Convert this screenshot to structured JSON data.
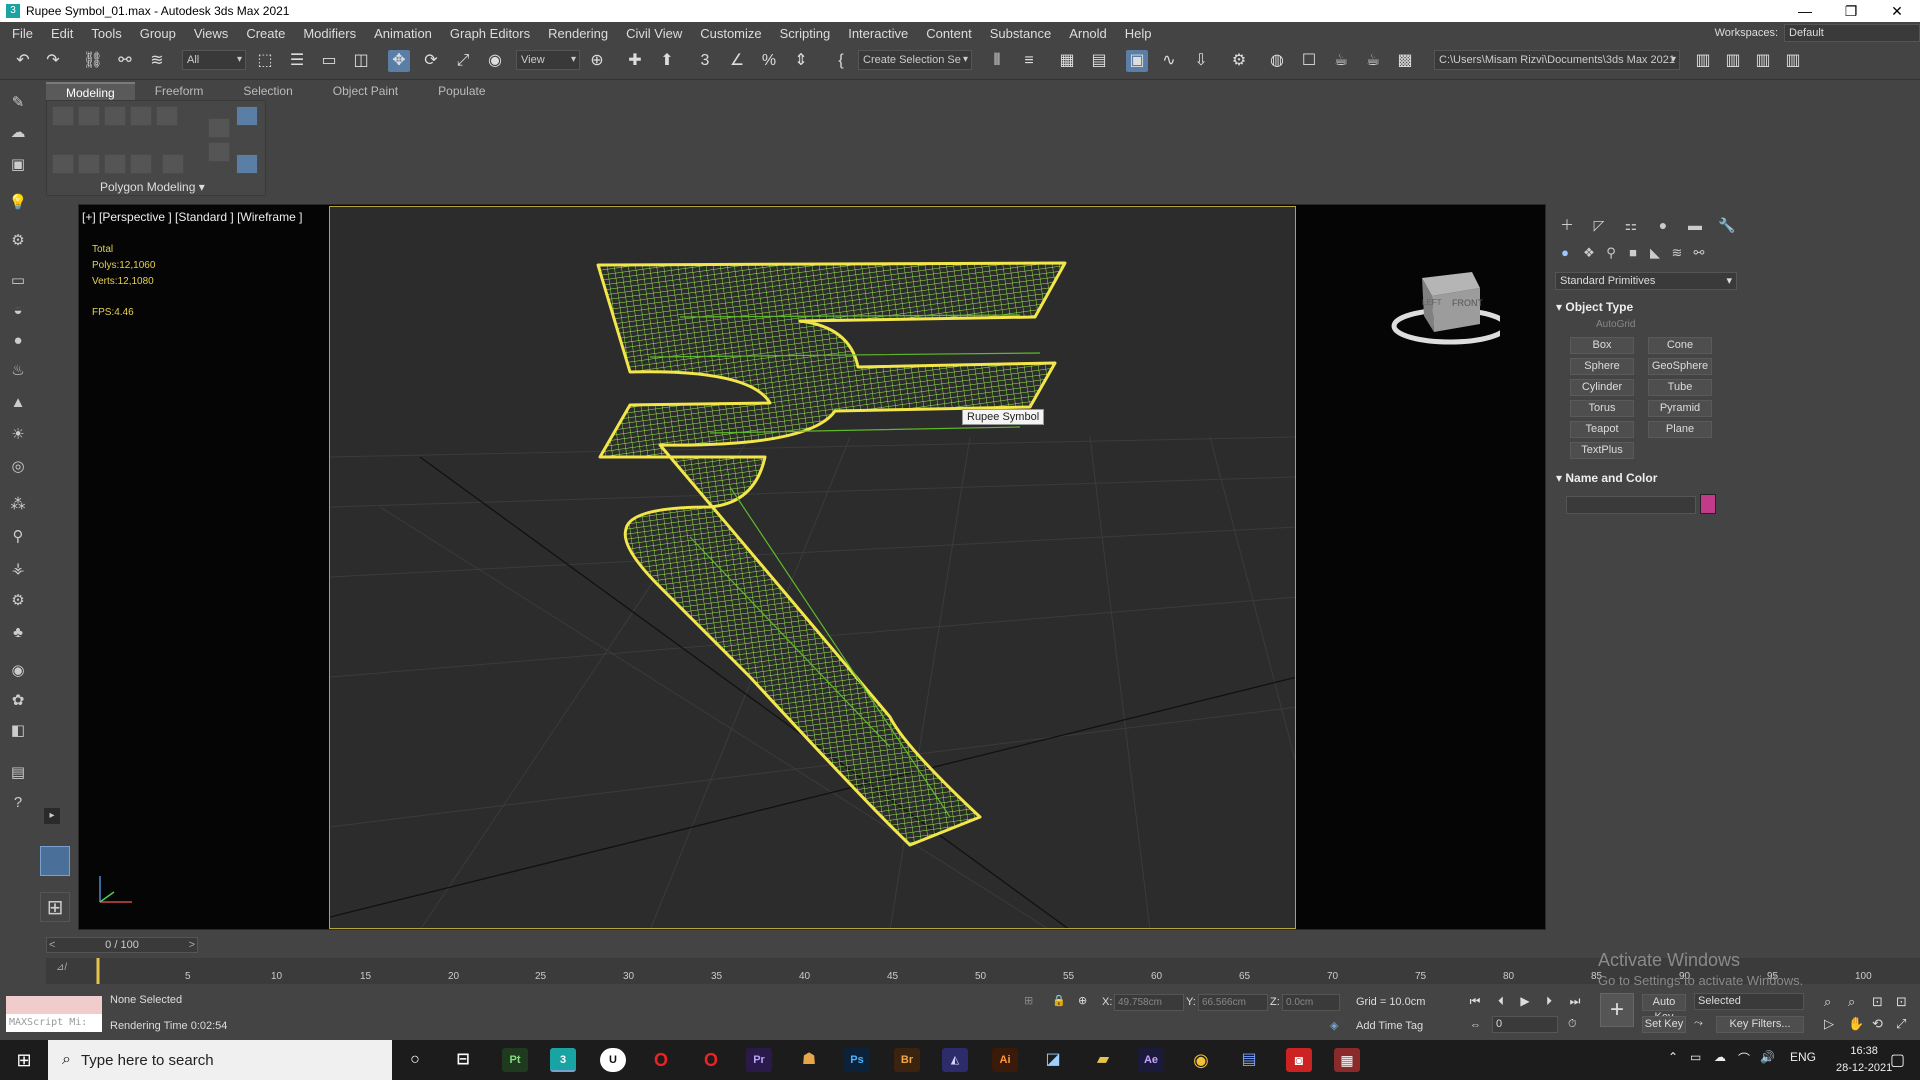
{
  "window": {
    "title": "Rupee Symbol_01.max - Autodesk 3ds Max 2021",
    "minimize": "—",
    "restore": "❐",
    "close": "✕"
  },
  "menu": [
    "File",
    "Edit",
    "Tools",
    "Group",
    "Views",
    "Create",
    "Modifiers",
    "Animation",
    "Graph Editors",
    "Rendering",
    "Civil View",
    "Customize",
    "Scripting",
    "Interactive",
    "Content",
    "Substance",
    "Arnold",
    "Help"
  ],
  "workspaces": {
    "label": "Workspaces:",
    "value": "Default"
  },
  "toolbar": {
    "selection_filter": "All",
    "ref_coord": "View",
    "named_selection": "Create Selection Se",
    "project_path": "C:\\Users\\Misam Rizvi\\Documents\\3ds Max 2021"
  },
  "ribbon": {
    "tabs": [
      "Modeling",
      "Freeform",
      "Selection",
      "Object Paint",
      "Populate"
    ],
    "active_tab": "Modeling",
    "panel_label": "Polygon Modeling"
  },
  "viewport": {
    "label": "[+] [Perspective ] [Standard ] [Wireframe ]",
    "stats_header": "Total",
    "polys_label": "Polys:",
    "polys_value": "12,106",
    "polys_sel": "0",
    "verts_label": "Verts:",
    "verts_value": "12,108",
    "verts_sel": "0",
    "fps_label": "FPS:",
    "fps_value": "4.46",
    "tooltip": "Rupee Symbol",
    "viewcube_front": "FRONT",
    "viewcube_left": "LEFT"
  },
  "command_panel": {
    "dropdown": "Standard Primitives",
    "object_type_title": "Object Type",
    "autogrid": "AutoGrid",
    "buttons": [
      "Box",
      "Cone",
      "Sphere",
      "GeoSphere",
      "Cylinder",
      "Tube",
      "Torus",
      "Pyramid",
      "Teapot",
      "Plane",
      "TextPlus"
    ],
    "name_color_title": "Name and Color",
    "swatch_color": "#c23a8a"
  },
  "timeline": {
    "slider": "0 / 100",
    "ticks": [
      "5",
      "10",
      "15",
      "20",
      "25",
      "30",
      "35",
      "40",
      "45",
      "50",
      "55",
      "60",
      "65",
      "70",
      "75",
      "80",
      "85",
      "90",
      "95",
      "100"
    ]
  },
  "status": {
    "maxscript": "MAXScript Mi:",
    "selection": "None Selected",
    "render_time": "Rendering Time  0:02:54",
    "x_label": "X:",
    "x_value": "49.758cm",
    "y_label": "Y:",
    "y_value": "66.566cm",
    "z_label": "Z:",
    "z_value": "0.0cm",
    "grid": "Grid = 10.0cm",
    "add_time_tag": "Add Time Tag",
    "frame": "0",
    "auto_key": "Auto Key",
    "selected": "Selected",
    "set_key": "Set Key",
    "key_filters": "Key Filters..."
  },
  "watermark": {
    "line1": "Activate Windows",
    "line2": "Go to Settings to activate Windows."
  },
  "taskbar": {
    "search_placeholder": "Type here to search",
    "apps": [
      "Pt",
      "3",
      "U",
      "O",
      "O",
      "Pr",
      "",
      "Ps",
      "Br",
      "",
      "Ai",
      "",
      "",
      "Ae",
      "",
      "",
      "",
      ""
    ],
    "language": "ENG",
    "time": "16:38",
    "date": "28-12-2021"
  },
  "colors": {
    "wire": "#86e63a",
    "selection_outline": "#f2e64a",
    "safe_frame": "#b7a33a"
  }
}
